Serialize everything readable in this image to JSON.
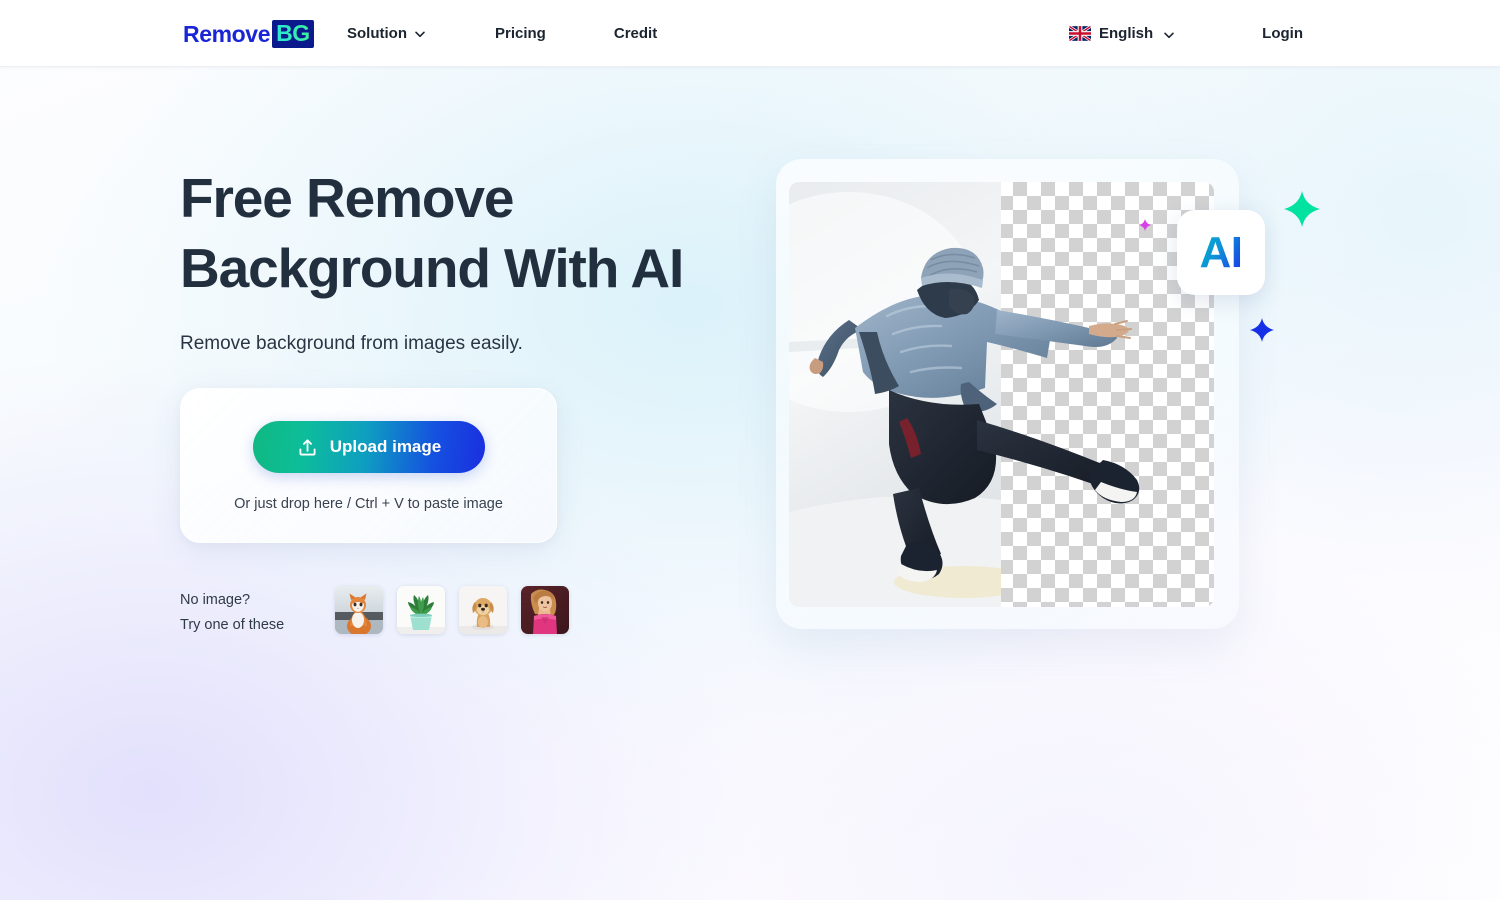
{
  "header": {
    "logo": {
      "part1": "Remove",
      "part2": "BG",
      "name": "RemoveBG"
    },
    "nav": [
      {
        "label": "Solution",
        "has_dropdown": true,
        "icon": "chevron-down-icon"
      },
      {
        "label": "Pricing",
        "has_dropdown": false
      },
      {
        "label": "Credit",
        "has_dropdown": false
      }
    ],
    "language": {
      "label": "English",
      "flag": "uk-flag-icon",
      "chevron": "chevron-down-icon"
    },
    "login_label": "Login"
  },
  "hero": {
    "title": "Free Remove\nBackground With AI",
    "subtitle": "Remove background from images easily."
  },
  "upload": {
    "button_label": "Upload image",
    "button_icon": "upload-icon",
    "hint": "Or just drop here / Ctrl + V to paste image"
  },
  "samples": {
    "label_line1": "No image?",
    "label_line2": "Try one of these",
    "items": [
      {
        "name": "sample-cat",
        "alt": "Orange and white cat"
      },
      {
        "name": "sample-plant",
        "alt": "Aloe plant in mint pot"
      },
      {
        "name": "sample-dog",
        "alt": "Golden retriever puppy"
      },
      {
        "name": "sample-portrait",
        "alt": "Woman in pink top"
      }
    ]
  },
  "preview": {
    "badge_text": "AI",
    "image_alt": "Person jumping in denim jacket with background removed",
    "decorations": [
      {
        "name": "sparkle-green",
        "color": "#00e2a0"
      },
      {
        "name": "sparkle-blue",
        "color": "#1630e8"
      },
      {
        "name": "sparkle-pink",
        "color": "#d93fe8"
      }
    ]
  },
  "colors": {
    "brand_blue": "#1a25d6",
    "brand_navy": "#0a1a8c",
    "brand_green": "#29e8d6",
    "accent_gradient_start": "#10b981",
    "accent_gradient_end": "#1a2ee0",
    "heading": "#222f3f",
    "body_text": "#2a3543"
  }
}
